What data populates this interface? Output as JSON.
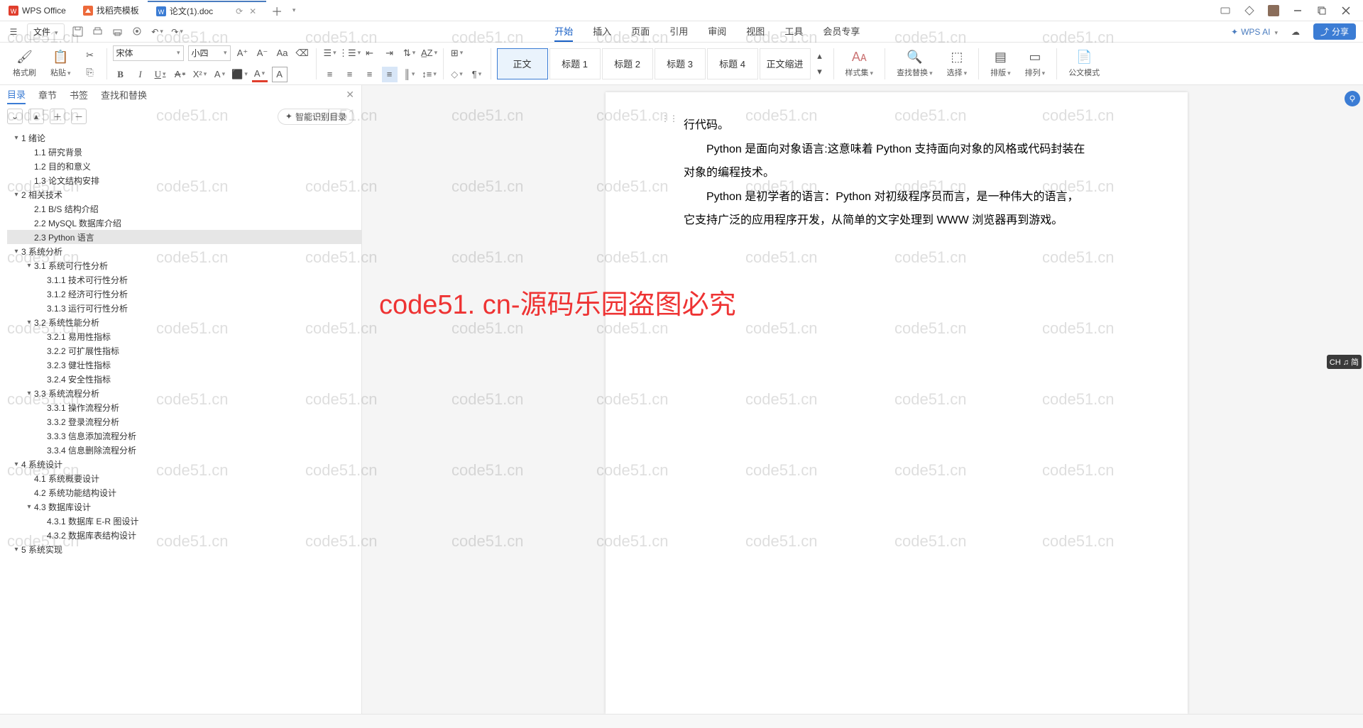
{
  "tabs": {
    "app": "WPS Office",
    "template": "找稻壳模板",
    "doc": "论文(1).doc"
  },
  "file_menu": "文件",
  "menu": {
    "start": "开始",
    "insert": "插入",
    "page": "页面",
    "reference": "引用",
    "review": "审阅",
    "view": "视图",
    "tools": "工具",
    "member": "会员专享",
    "wps_ai": "WPS AI"
  },
  "share": "分享",
  "ribbon": {
    "format_painter": "格式刷",
    "paste": "粘贴",
    "font_name": "宋体",
    "font_size": "小四",
    "style_set": "样式集",
    "find_replace": "查找替换",
    "select": "选择",
    "sort": "排版",
    "arrange": "排列",
    "gov_mode": "公文模式"
  },
  "styles": {
    "body": "正文",
    "h1": "标题 1",
    "h2": "标题 2",
    "h3": "标题 3",
    "h4": "标题 4",
    "indent": "正文缩进"
  },
  "sidebar": {
    "tab_toc": "目录",
    "tab_chapter": "章节",
    "tab_bookmark": "书签",
    "tab_find": "查找和替换",
    "smart_toc": "智能识别目录"
  },
  "toc": [
    {
      "lvl": 1,
      "caret": true,
      "label": "1 绪论"
    },
    {
      "lvl": 2,
      "caret": false,
      "label": "1.1 研究背景"
    },
    {
      "lvl": 2,
      "caret": false,
      "label": "1.2 目的和意义"
    },
    {
      "lvl": 2,
      "caret": false,
      "label": "1.3 论文结构安排"
    },
    {
      "lvl": 1,
      "caret": true,
      "label": "2 相关技术"
    },
    {
      "lvl": 2,
      "caret": false,
      "label": "2.1 B/S 结构介绍"
    },
    {
      "lvl": 2,
      "caret": false,
      "label": "2.2 MySQL 数据库介绍"
    },
    {
      "lvl": 2,
      "caret": false,
      "label": "2.3 Python 语言",
      "selected": true
    },
    {
      "lvl": 1,
      "caret": true,
      "label": "3 系统分析"
    },
    {
      "lvl": 2,
      "caret": true,
      "label": "3.1 系统可行性分析"
    },
    {
      "lvl": 3,
      "caret": false,
      "label": "3.1.1 技术可行性分析"
    },
    {
      "lvl": 3,
      "caret": false,
      "label": "3.1.2 经济可行性分析"
    },
    {
      "lvl": 3,
      "caret": false,
      "label": "3.1.3 运行可行性分析"
    },
    {
      "lvl": 2,
      "caret": true,
      "label": "3.2 系统性能分析"
    },
    {
      "lvl": 3,
      "caret": false,
      "label": "3.2.1 易用性指标"
    },
    {
      "lvl": 3,
      "caret": false,
      "label": "3.2.2 可扩展性指标"
    },
    {
      "lvl": 3,
      "caret": false,
      "label": "3.2.3 健壮性指标"
    },
    {
      "lvl": 3,
      "caret": false,
      "label": "3.2.4 安全性指标"
    },
    {
      "lvl": 2,
      "caret": true,
      "label": "3.3 系统流程分析"
    },
    {
      "lvl": 3,
      "caret": false,
      "label": "3.3.1 操作流程分析"
    },
    {
      "lvl": 3,
      "caret": false,
      "label": "3.3.2 登录流程分析"
    },
    {
      "lvl": 3,
      "caret": false,
      "label": "3.3.3 信息添加流程分析"
    },
    {
      "lvl": 3,
      "caret": false,
      "label": "3.3.4 信息删除流程分析"
    },
    {
      "lvl": 1,
      "caret": true,
      "label": "4 系统设计"
    },
    {
      "lvl": 2,
      "caret": false,
      "label": "4.1 系统概要设计"
    },
    {
      "lvl": 2,
      "caret": false,
      "label": "4.2 系统功能结构设计"
    },
    {
      "lvl": 2,
      "caret": true,
      "label": "4.3 数据库设计"
    },
    {
      "lvl": 3,
      "caret": false,
      "label": "4.3.1 数据库 E-R 图设计"
    },
    {
      "lvl": 3,
      "caret": false,
      "label": "4.3.2 数据库表结构设计"
    },
    {
      "lvl": 1,
      "caret": true,
      "label": "5 系统实现"
    }
  ],
  "doc": {
    "l1": "行代码。",
    "l2": "Python 是面向对象语言:这意味着 Python 支持面向对象的风格或代码封装在",
    "l3": "对象的编程技术。",
    "l4": "Python 是初学者的语言：Python 对初级程序员而言，是一种伟大的语言，",
    "l5": "它支持广泛的应用程序开发，从简单的文字处理到 WWW 浏览器再到游戏。"
  },
  "watermark_text": "code51.cn",
  "overlay_red": "code51. cn-源码乐园盗图必究",
  "ime": "CH ♫ 简"
}
